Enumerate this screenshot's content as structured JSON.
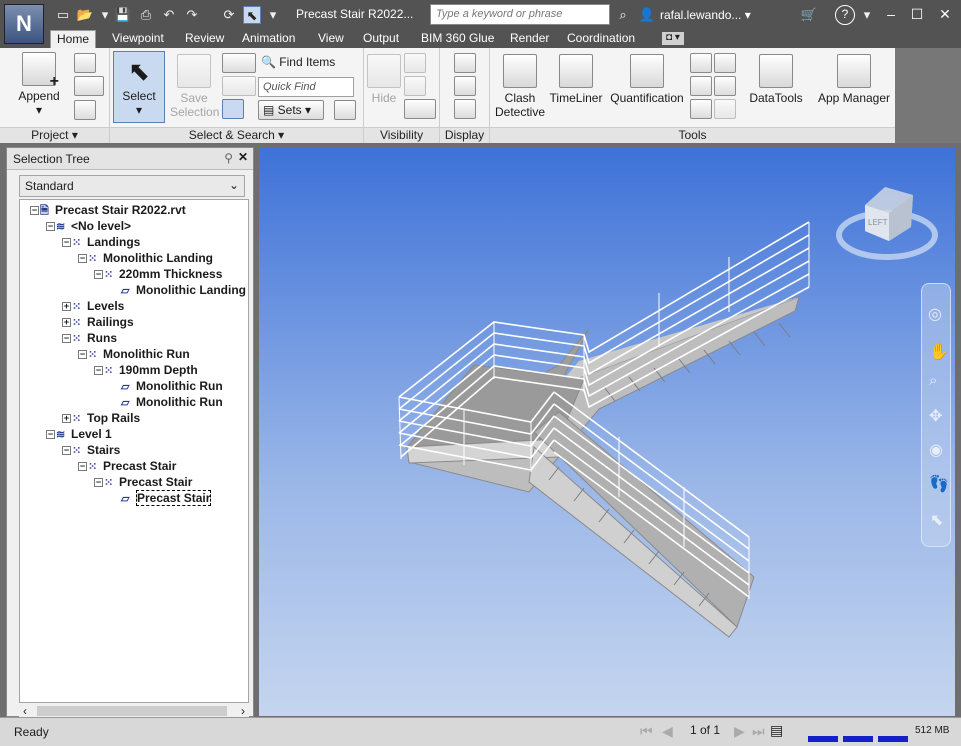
{
  "app": {
    "title": "Precast Stair R2022...",
    "logo_letter": "N",
    "search_placeholder": "Type a keyword or phrase",
    "user": "rafal.lewando...",
    "help_label": "?"
  },
  "tabs": [
    "Home",
    "Viewpoint",
    "Review",
    "Animation",
    "View",
    "Output",
    "BIM 360 Glue",
    "Render",
    "Coordination"
  ],
  "ribbon": {
    "append_label": "Append",
    "select_label": "Select",
    "save_selection_label": [
      "Save",
      "Selection"
    ],
    "find_items_label": "Find Items",
    "quick_find_placeholder": "Quick Find",
    "sets_label": "Sets",
    "hide_label": "Hide",
    "clash_label": [
      "Clash",
      "Detective"
    ],
    "timeliner_label": "TimeLiner",
    "quantification_label": "Quantification",
    "datatools_label": "DataTools",
    "app_manager_label": "App Manager",
    "panels": {
      "project": "Project",
      "select_search": "Select & Search",
      "visibility": "Visibility",
      "display": "Display",
      "tools": "Tools"
    }
  },
  "selection_tree": {
    "title": "Selection Tree",
    "mode": "Standard",
    "nodes": [
      {
        "label": "Precast Stair R2022.rvt",
        "depth": 0,
        "icon": "file-icon",
        "expander": "−"
      },
      {
        "label": "<No level>",
        "depth": 1,
        "icon": "level-icon",
        "expander": "−"
      },
      {
        "label": "Landings",
        "depth": 2,
        "icon": "group-icon",
        "expander": "−"
      },
      {
        "label": "Monolithic Landing",
        "depth": 3,
        "icon": "group-icon",
        "expander": "−"
      },
      {
        "label": "220mm Thickness",
        "depth": 4,
        "icon": "group-icon",
        "expander": "−"
      },
      {
        "label": "Monolithic Landing",
        "depth": 5,
        "icon": "object-icon",
        "expander": ""
      },
      {
        "label": "Levels",
        "depth": 2,
        "icon": "group-icon",
        "expander": "+"
      },
      {
        "label": "Railings",
        "depth": 2,
        "icon": "group-icon",
        "expander": "+"
      },
      {
        "label": "Runs",
        "depth": 2,
        "icon": "group-icon",
        "expander": "−"
      },
      {
        "label": "Monolithic Run",
        "depth": 3,
        "icon": "group-icon",
        "expander": "−"
      },
      {
        "label": "190mm Depth",
        "depth": 4,
        "icon": "group-icon",
        "expander": "−"
      },
      {
        "label": "Monolithic Run",
        "depth": 5,
        "icon": "object-icon",
        "expander": ""
      },
      {
        "label": "Monolithic Run",
        "depth": 5,
        "icon": "object-icon",
        "expander": ""
      },
      {
        "label": "Top Rails",
        "depth": 2,
        "icon": "group-icon",
        "expander": "+"
      },
      {
        "label": "Level 1",
        "depth": 1,
        "icon": "level-icon",
        "expander": "−"
      },
      {
        "label": "Stairs",
        "depth": 2,
        "icon": "group-icon",
        "expander": "−"
      },
      {
        "label": "Precast Stair",
        "depth": 3,
        "icon": "group-icon",
        "expander": "−"
      },
      {
        "label": "Precast Stair",
        "depth": 4,
        "icon": "group-icon",
        "expander": "−"
      },
      {
        "label": "Precast Stair",
        "depth": 5,
        "icon": "object-icon",
        "expander": "",
        "focused": true
      }
    ]
  },
  "viewcube_label": "LEFT",
  "status": {
    "text": "Ready",
    "page": "1 of 1",
    "memory": "512 MB"
  }
}
